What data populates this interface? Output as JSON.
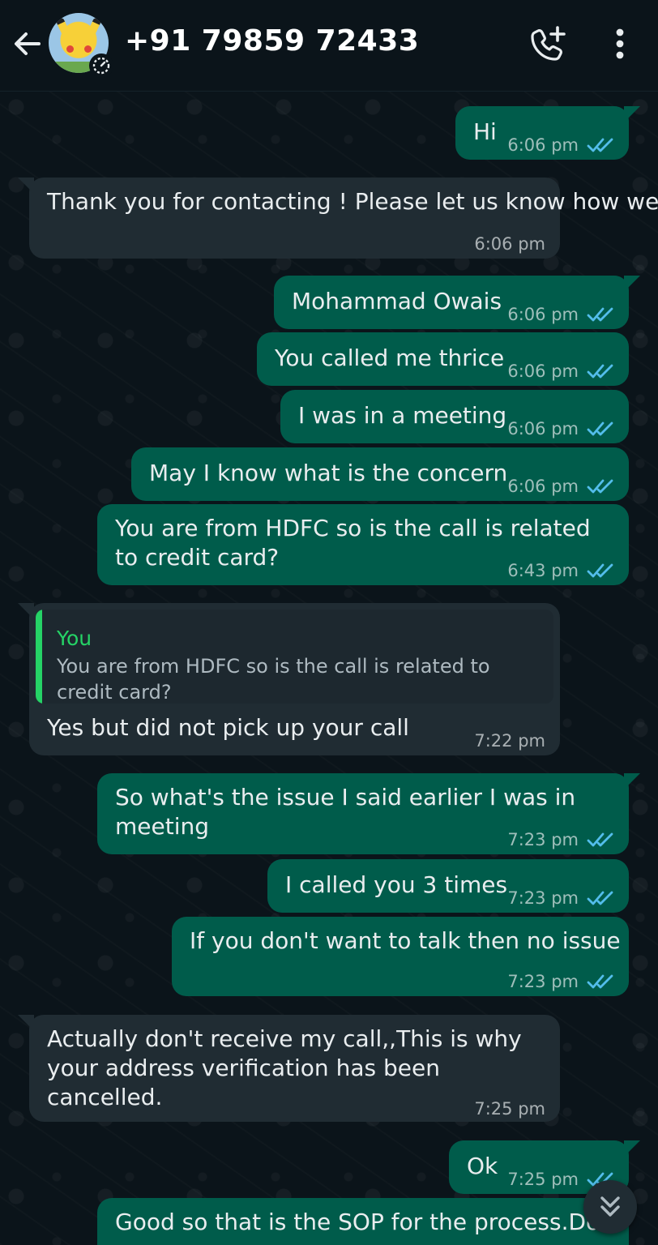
{
  "header": {
    "contact_name": "+91 79859 72433"
  },
  "icons": {
    "back": "back-arrow-icon",
    "add_call": "add-call-icon",
    "menu": "more-vert-icon",
    "status": "status-timer-icon",
    "scroll": "double-chevron-down-icon"
  },
  "colors": {
    "background": "#0b141a",
    "outgoing_bubble": "#005c4b",
    "incoming_bubble": "#202c33",
    "read_tick": "#53bdeb",
    "quote_accent": "#25d366"
  },
  "messages": [
    {
      "dir": "out",
      "text": "Hi",
      "time": "6:06 pm",
      "status": "read"
    },
    {
      "dir": "in",
      "text": "Thank you for contacting ! Please let us know how we can help you.",
      "time": "6:06 pm"
    },
    {
      "dir": "out",
      "text": "Mohammad Owais",
      "time": "6:06 pm",
      "status": "read"
    },
    {
      "dir": "out",
      "text": "You called me thrice",
      "time": "6:06 pm",
      "status": "read"
    },
    {
      "dir": "out",
      "text": "I was in a meeting",
      "time": "6:06 pm",
      "status": "read"
    },
    {
      "dir": "out",
      "text": "May I know what is the concern",
      "time": "6:06 pm",
      "status": "read"
    },
    {
      "dir": "out",
      "text": "You are from HDFC so is the call is related to credit card?",
      "time": "6:43 pm",
      "status": "read"
    },
    {
      "dir": "in",
      "quote_author": "You",
      "quote_text": "You are from HDFC so is the call is related to credit card?",
      "text": "Yes but did not pick up your call",
      "time": "7:22 pm"
    },
    {
      "dir": "out",
      "text": "So what's the issue I said earlier I was in meeting",
      "time": "7:23 pm",
      "status": "read"
    },
    {
      "dir": "out",
      "text": "I called you 3 times",
      "time": "7:23 pm",
      "status": "read"
    },
    {
      "dir": "out",
      "text": "If you don't want to talk then no issue",
      "time": "7:23 pm",
      "status": "read"
    },
    {
      "dir": "in",
      "text": "Actually don't receive my call,,This is why your address verification has been cancelled.",
      "time": "7:25 pm"
    },
    {
      "dir": "out",
      "text": "Ok",
      "time": "7:25 pm",
      "status": "read"
    },
    {
      "dir": "out",
      "text": "Good so that is the SOP for the process.Do",
      "time": "",
      "status": "partial"
    }
  ]
}
